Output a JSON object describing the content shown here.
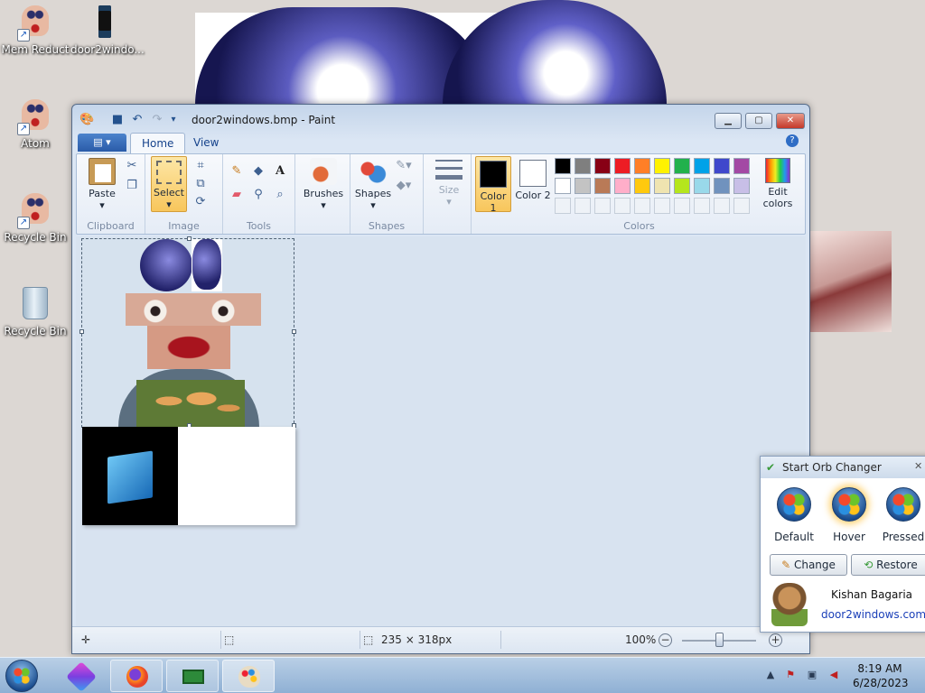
{
  "desktop": {
    "icons": [
      {
        "label": "Mem Reduct"
      },
      {
        "label": "door2windo..."
      },
      {
        "label": "Atom"
      },
      {
        "label": "Recycle Bin"
      },
      {
        "label": "Recycle Bin"
      }
    ]
  },
  "paint": {
    "title": "door2windows.bmp - Paint",
    "tabs": [
      "Home",
      "View"
    ],
    "groups": {
      "clipboard": "Clipboard",
      "image": "Image",
      "tools": "Tools",
      "shapes": "Shapes",
      "colors": "Colors"
    },
    "buttons": {
      "paste": "Paste",
      "select": "Select",
      "brushes": "Brushes",
      "shapes": "Shapes",
      "size": "Size",
      "color1": "Color 1",
      "color2": "Color 2",
      "edit_colors": "Edit colors"
    },
    "palette": [
      "#000000",
      "#7f7f7f",
      "#880015",
      "#ed1c24",
      "#ff7f27",
      "#fff200",
      "#22b14c",
      "#00a2e8",
      "#3f48cc",
      "#a349a4",
      "#ffffff",
      "#c3c3c3",
      "#b97a57",
      "#ffaec9",
      "#ffc90e",
      "#efe4b0",
      "#b5e61d",
      "#99d9ea",
      "#7092be",
      "#c8bfe7"
    ],
    "color1": "#000000",
    "color2": "#ffffff",
    "status": {
      "dimensions": "235 × 318px",
      "zoom": "100%"
    }
  },
  "orb_changer": {
    "title": "Start Orb Changer",
    "orbs": [
      "Default",
      "Hover",
      "Pressed"
    ],
    "change_label": "Change",
    "restore_label": "Restore",
    "author": "Kishan Bagaria",
    "site": "door2windows.com"
  },
  "taskbar": {
    "time": "8:19 AM",
    "date": "6/28/2023"
  }
}
